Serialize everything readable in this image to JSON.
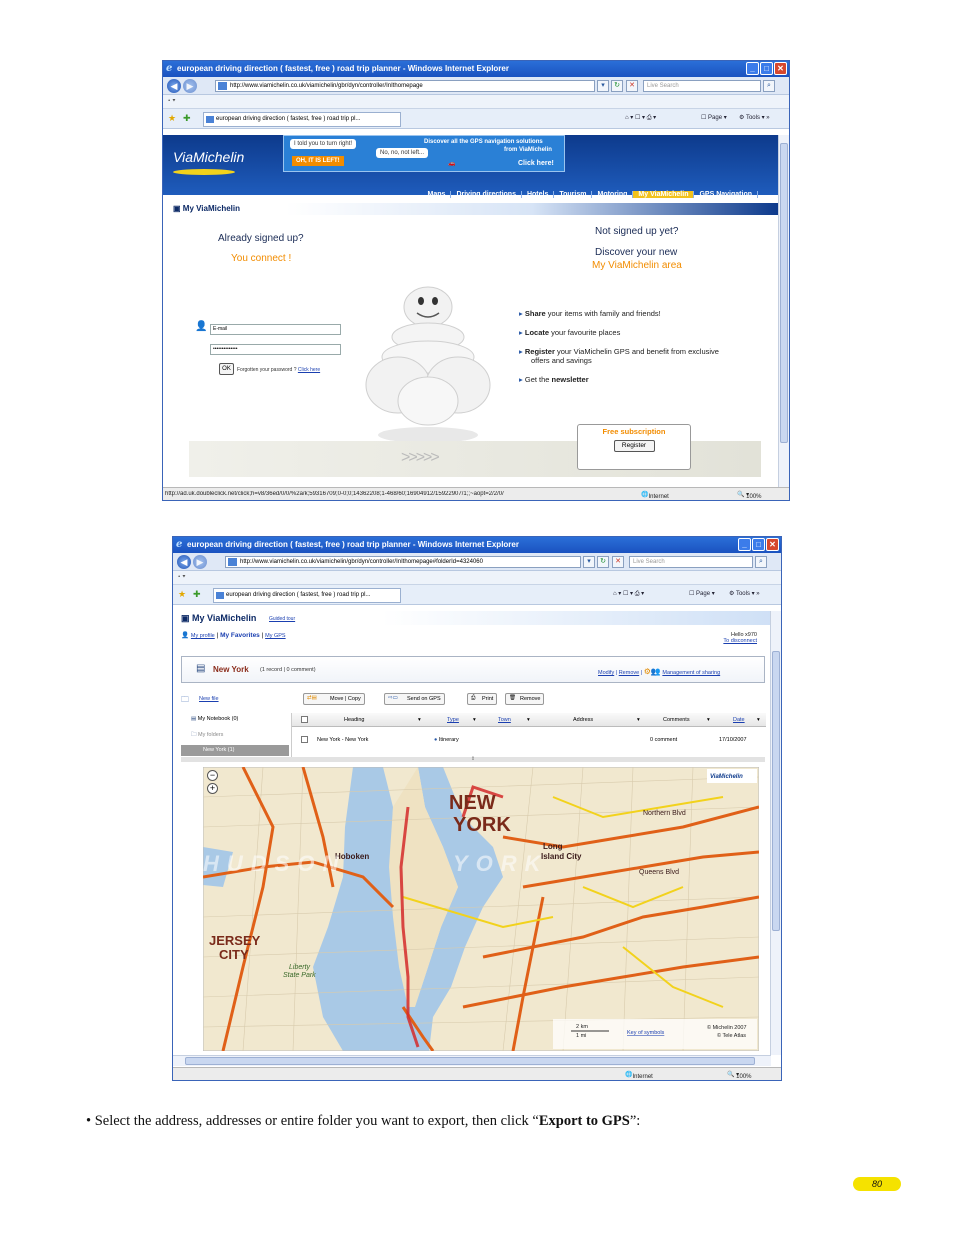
{
  "window1": {
    "title": "european driving direction ( fastest, free ) road trip planner - Windows Internet Explorer",
    "url": "http://www.viamichelin.co.uk/viamichelin/gbr/dyn/controller/InIthomepage",
    "search_placeholder": "Live Search",
    "tab_title": "european driving direction ( fastest, free ) road trip pl...",
    "toolbar": {
      "page": "Page",
      "tools": "Tools"
    },
    "logo": "ViaMichelin",
    "banner": {
      "bubble1": "I told you to turn right!",
      "bubble2": "No, no, not left...",
      "bubble3": "OH, IT IS LEFT!",
      "promo_line1": "Discover all the GPS navigation solutions",
      "promo_line2": "from ViaMichelin",
      "click_here": "Click here!"
    },
    "nav": [
      "Maps",
      "Driving directions",
      "Hotels",
      "Tourism",
      "Motoring",
      "My ViaMichelin",
      "GPS Navigation"
    ],
    "section_title": "My ViaMichelin",
    "login": {
      "already": "Already signed up?",
      "connect": "You connect !",
      "email_value": "E-mail",
      "password_value": "••••••••••••••",
      "ok": "OK",
      "forgot": "Forgotten your password ?",
      "click_here": "Click here"
    },
    "signup": {
      "not_yet": "Not signed up yet?",
      "discover": "Discover your new",
      "area": "My ViaMichelin area",
      "benefits": [
        {
          "bold": "Share",
          "rest": " your items with family and friends!"
        },
        {
          "bold": "Locate",
          "rest": " your favourite places"
        },
        {
          "bold": "Register",
          "rest": " your ViaMichelin GPS and benefit from exclusive offers and savings"
        },
        {
          "bold_pre": "Get the ",
          "bold": "newsletter",
          "rest": ""
        }
      ],
      "free_subscription": "Free subscription",
      "register": "Register"
    },
    "status": {
      "url": "http://ad.uk.doubleclick.net/click;h=v8/36ed/0/0/%2a/k;59316709;0-0;0;14362208;1-468/60;16904912/15922907/1;;~aopt=2/2/0/",
      "zone": "Internet",
      "zoom": "100%"
    }
  },
  "window2": {
    "title": "european driving direction ( fastest, free ) road trip planner - Windows Internet Explorer",
    "url": "http://www.viamichelin.co.uk/viamichelin/gbr/dyn/controller/InIthomepage#folderId=4324060",
    "search_placeholder": "Live Search",
    "tab_title": "european driving direction ( fastest, free ) road trip pl...",
    "toolbar": {
      "page": "Page",
      "tools": "Tools"
    },
    "header": {
      "title": "My ViaMichelin",
      "guided_tour": "Guided tour",
      "my_profile": "My profile",
      "my_favorites": "My Favorites",
      "my_gps": "My GPS",
      "hello": "Hello x970",
      "disconnect": "To disconnect"
    },
    "folder": {
      "name": "New York",
      "meta": "(1 record | 0 comment)",
      "modify": "Modify",
      "remove": "Remove",
      "sharing": "Management of sharing"
    },
    "actions": {
      "new_file": "New file",
      "move_copy": "Move | Copy",
      "send_gps": "Send on GPS",
      "print": "Print",
      "remove": "Remove"
    },
    "tree": {
      "notebook": "My Notebook (0)",
      "folders": "My folders",
      "selected": "New York (1)"
    },
    "table": {
      "headers": [
        "Heading",
        "Type",
        "Town",
        "Address",
        "Comments",
        "Date"
      ],
      "rows": [
        {
          "heading": "New York - New York",
          "type": "Itinerary",
          "town": "",
          "address": "",
          "comments": "0 comment",
          "date": "17/10/2007"
        }
      ]
    },
    "map": {
      "city_label_1": "NEW",
      "city_label_2": "YORK",
      "jersey_1": "JERSEY",
      "jersey_2": "CITY",
      "hoboken": "Hoboken",
      "long_island": "Long",
      "long_island_2": "Island City",
      "liberty": "Liberty",
      "liberty_2": "State Park",
      "hudson": "HUDSON",
      "york": "YORK",
      "brand": "ViaMichelin",
      "scale_km": "2 km",
      "scale_mi": "1 mi",
      "key": "Key of symbols",
      "copyright1": "© Michelin 2007",
      "copyright2": "© Tele Atlas",
      "queens": "Queens Blvd",
      "northern": "Northern Blvd"
    },
    "status": {
      "zone": "Internet",
      "zoom": "100%"
    }
  },
  "caption": {
    "prefix": "• Select the address, addresses or entire folder you want to export, then click “",
    "bold": "Export to GPS",
    "suffix": "”:"
  },
  "page_number": "80",
  "colors": {
    "ie_title": "#1a52c0",
    "vm_blue": "#0d3a8c",
    "vm_orange": "#f28c00",
    "vm_yellow": "#f2c21c",
    "page_badge": "#f5e200"
  }
}
